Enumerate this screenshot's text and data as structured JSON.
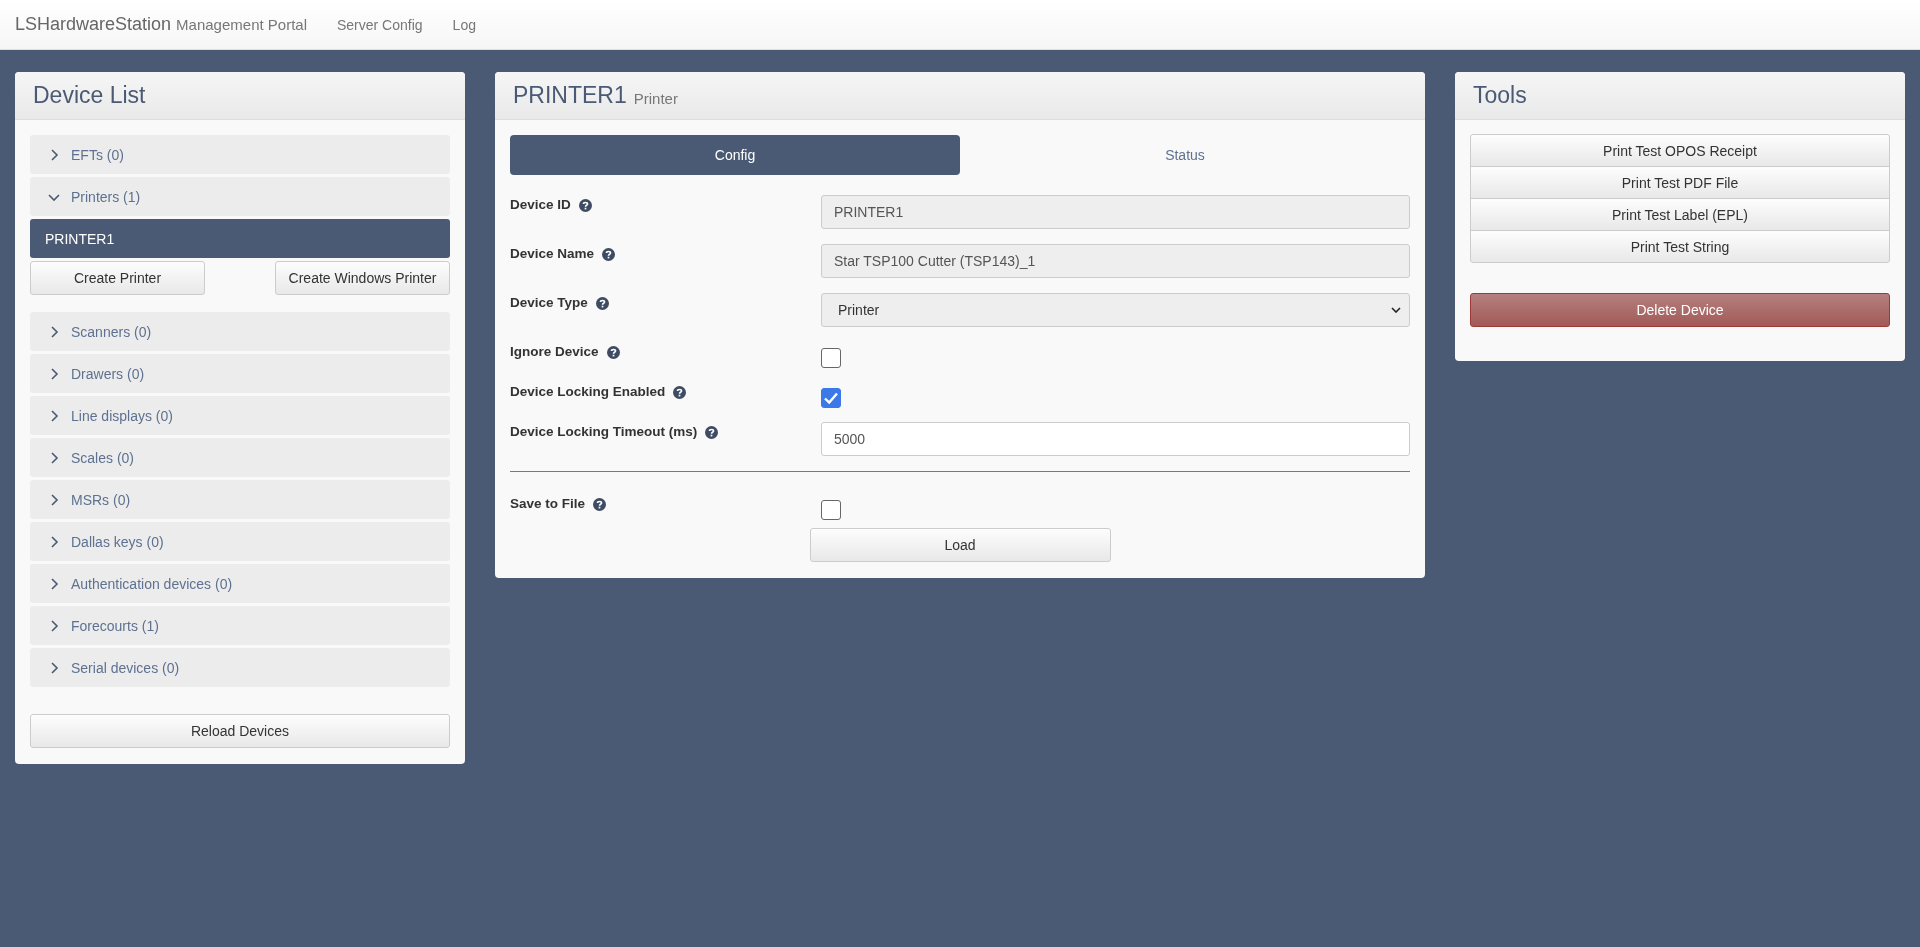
{
  "navbar": {
    "brand": "LSHardwareStation",
    "brand_sub": "Management Portal",
    "links": [
      "Server Config",
      "Log"
    ]
  },
  "device_list": {
    "title": "Device List",
    "groups": [
      {
        "label": "EFTs (0)",
        "expanded": false
      },
      {
        "label": "Printers (1)",
        "expanded": true,
        "devices": [
          {
            "label": "PRINTER1",
            "selected": true
          }
        ],
        "buttons": [
          "Create Printer",
          "Create Windows Printer"
        ]
      },
      {
        "label": "Scanners (0)",
        "expanded": false
      },
      {
        "label": "Drawers (0)",
        "expanded": false
      },
      {
        "label": "Line displays (0)",
        "expanded": false
      },
      {
        "label": "Scales (0)",
        "expanded": false
      },
      {
        "label": "MSRs (0)",
        "expanded": false
      },
      {
        "label": "Dallas keys (0)",
        "expanded": false
      },
      {
        "label": "Authentication devices (0)",
        "expanded": false
      },
      {
        "label": "Forecourts (1)",
        "expanded": false
      },
      {
        "label": "Serial devices (0)",
        "expanded": false
      }
    ],
    "reload_button": "Reload Devices"
  },
  "device": {
    "title": "PRINTER1",
    "subtitle": "Printer",
    "tabs": [
      {
        "label": "Config",
        "selected": true
      },
      {
        "label": "Status",
        "selected": false
      }
    ],
    "fields": [
      {
        "kind": "text",
        "label": "Device ID",
        "value": "PRINTER1",
        "disabled": true
      },
      {
        "kind": "text",
        "label": "Device Name",
        "value": "Star TSP100 Cutter (TSP143)_1",
        "disabled": true
      },
      {
        "kind": "select",
        "label": "Device Type",
        "value": "Printer"
      },
      {
        "kind": "checkbox",
        "label": "Ignore Device",
        "checked": false
      },
      {
        "kind": "checkbox",
        "label": "Device Locking Enabled",
        "checked": true
      },
      {
        "kind": "text",
        "label": "Device Locking Timeout (ms)",
        "value": "5000",
        "disabled": false
      },
      {
        "kind": "divider"
      },
      {
        "kind": "checkbox",
        "label": "Save to File",
        "checked": false
      }
    ],
    "load_button": "Load"
  },
  "tools": {
    "title": "Tools",
    "buttons": [
      "Print Test OPOS Receipt",
      "Print Test PDF File",
      "Print Test Label (EPL)",
      "Print Test String"
    ],
    "delete_button": "Delete Device"
  }
}
